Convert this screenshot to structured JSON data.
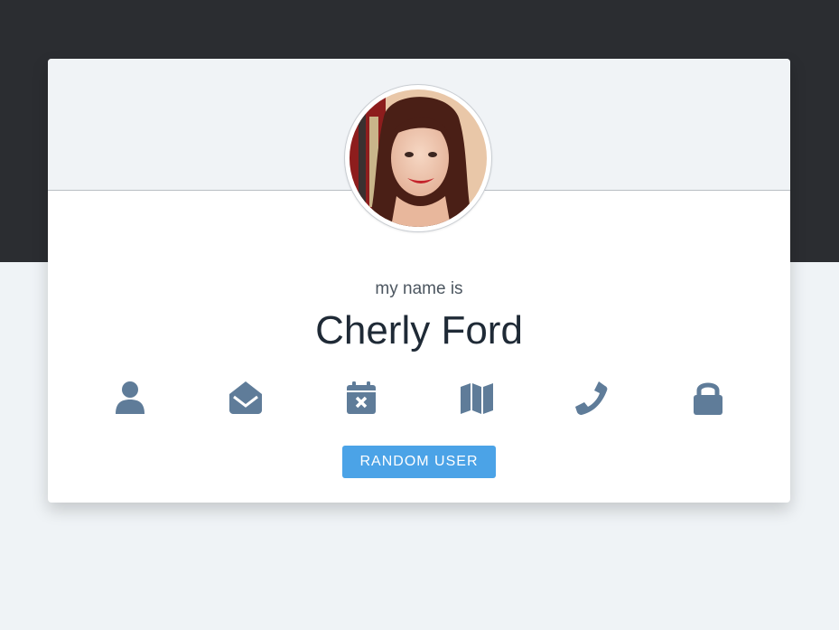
{
  "profile": {
    "label": "my name is",
    "value": "Cherly Ford"
  },
  "icons": [
    {
      "name": "user-icon"
    },
    {
      "name": "email-icon"
    },
    {
      "name": "calendar-icon"
    },
    {
      "name": "map-icon"
    },
    {
      "name": "phone-icon"
    },
    {
      "name": "lock-icon"
    }
  ],
  "actions": {
    "random_label": "RANDOM USER"
  },
  "colors": {
    "dark_band": "#2b2d31",
    "icon": "#5f7c99",
    "button": "#4ba3e7",
    "card_header": "#f0f3f6"
  }
}
